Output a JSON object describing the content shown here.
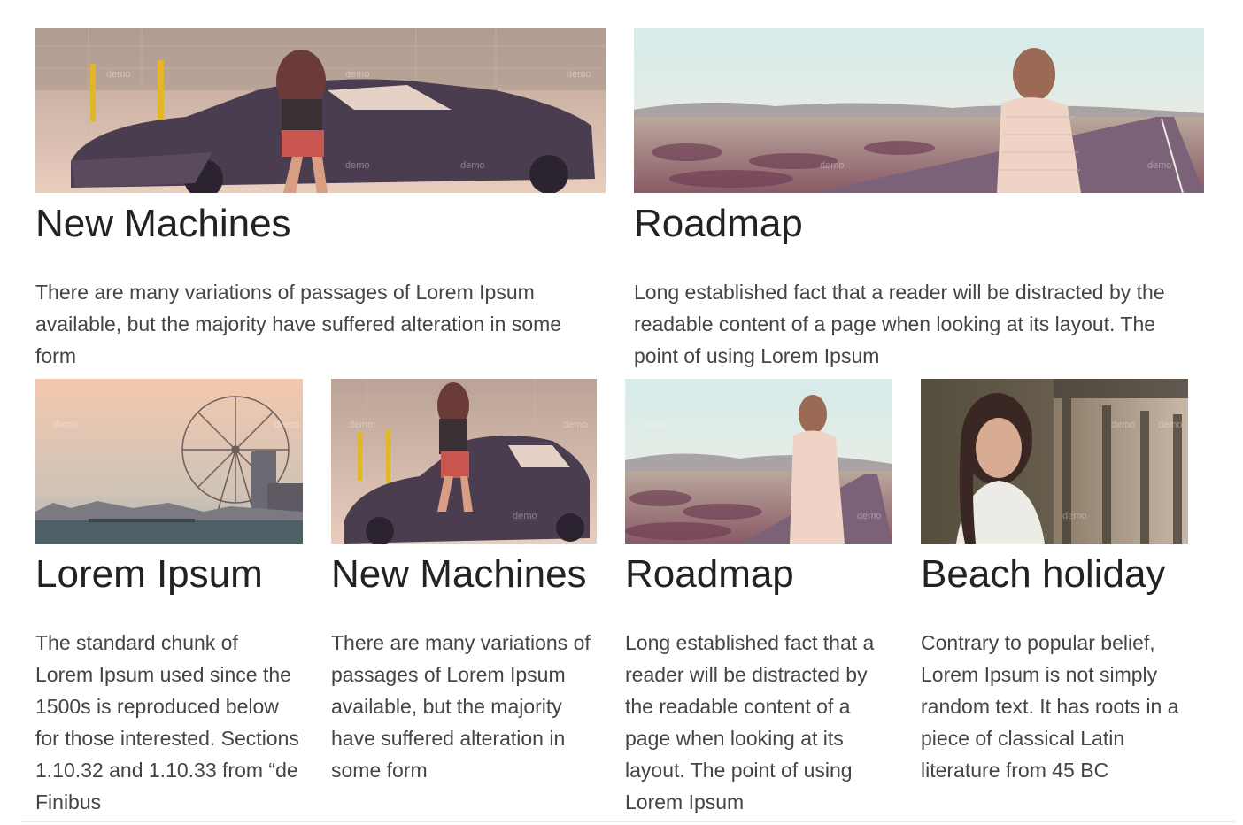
{
  "featured": [
    {
      "title": "New Machines",
      "description": "There are many variations of passages of Lorem Ipsum available, but the majority have suffered alteration in some form",
      "image": "woman-on-classic-car-photo"
    },
    {
      "title": "Roadmap",
      "description": "Long established fact that a reader will be distracted by the readable content of a page when looking at its layout. The point of using Lorem Ipsum",
      "image": "woman-on-desert-road-photo"
    }
  ],
  "grid": [
    {
      "title": "Lorem Ipsum",
      "description": "The standard chunk of Lorem Ipsum used since the 1500s is reproduced below for those interested. Sections 1.10.32 and 1.10.33 from “de Finibus",
      "image": "london-eye-cityscape-photo"
    },
    {
      "title": "New Machines",
      "description": "There are many variations of passages of Lorem Ipsum available, but the majority have suffered alteration in some form",
      "image": "woman-on-classic-car-photo"
    },
    {
      "title": "Roadmap",
      "description": "Long established fact that a reader will be distracted by the readable content of a page when looking at its layout. The point of using Lorem Ipsum",
      "image": "woman-on-desert-road-photo"
    },
    {
      "title": "Beach holiday",
      "description": "Contrary to popular belief, Lorem Ipsum is not simply random text. It has roots in a piece of classical Latin literature from 45 BC",
      "image": "woman-portrait-bridge-photo"
    }
  ],
  "watermark": "demo"
}
